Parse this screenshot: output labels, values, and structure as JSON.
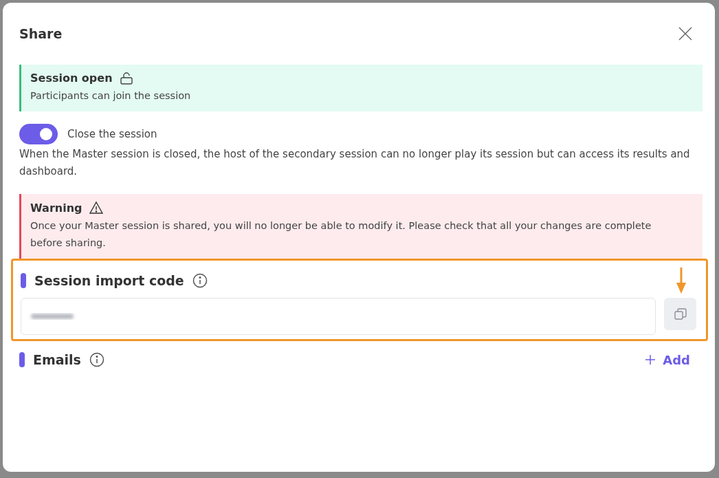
{
  "dialog": {
    "title": "Share"
  },
  "status_alert": {
    "title": "Session open",
    "text": "Participants can join the session"
  },
  "close_toggle": {
    "label": "Close the session",
    "on": true,
    "description": "When the Master session is closed, the host of the secondary session can no longer play its session but can access its results and dashboard."
  },
  "warning_alert": {
    "title": "Warning",
    "text": "Once your Master session is shared, you will no longer be able to modify it. Please check that all your changes are complete before sharing."
  },
  "import_code": {
    "title": "Session import code",
    "highlighted": true
  },
  "emails": {
    "title": "Emails",
    "add_label": "Add"
  }
}
